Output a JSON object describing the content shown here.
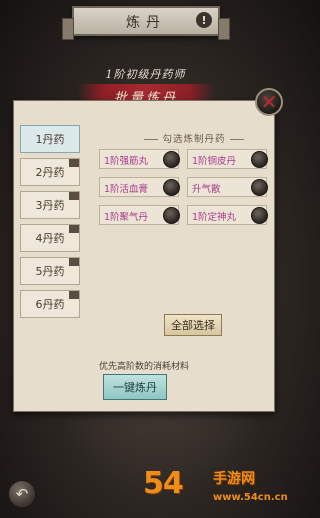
{
  "header": {
    "title": "炼丹",
    "info_symbol": "!"
  },
  "recipe": {
    "name": "1阶初级丹药师",
    "banner": "批量炼丹"
  },
  "close_symbol": "✕",
  "tabs": [
    {
      "label": "1丹药",
      "active": true
    },
    {
      "label": "2丹药"
    },
    {
      "label": "3丹药"
    },
    {
      "label": "4丹药"
    },
    {
      "label": "5丹药"
    },
    {
      "label": "6丹药"
    }
  ],
  "selection": {
    "header": "勾选炼制丹药",
    "items": [
      "1阶强筋丸",
      "1阶铜皮丹",
      "1阶活血膏",
      "升气散",
      "1阶聚气丹",
      "1阶定神丸"
    ]
  },
  "buttons": {
    "select_all": "全部选择",
    "one_click": "一键炼丹"
  },
  "hint": "优先高阶数的消耗材料",
  "back_symbol": "↶",
  "watermark": {
    "num": "54",
    "name": "手游网",
    "url": "www.54cn.cn"
  }
}
